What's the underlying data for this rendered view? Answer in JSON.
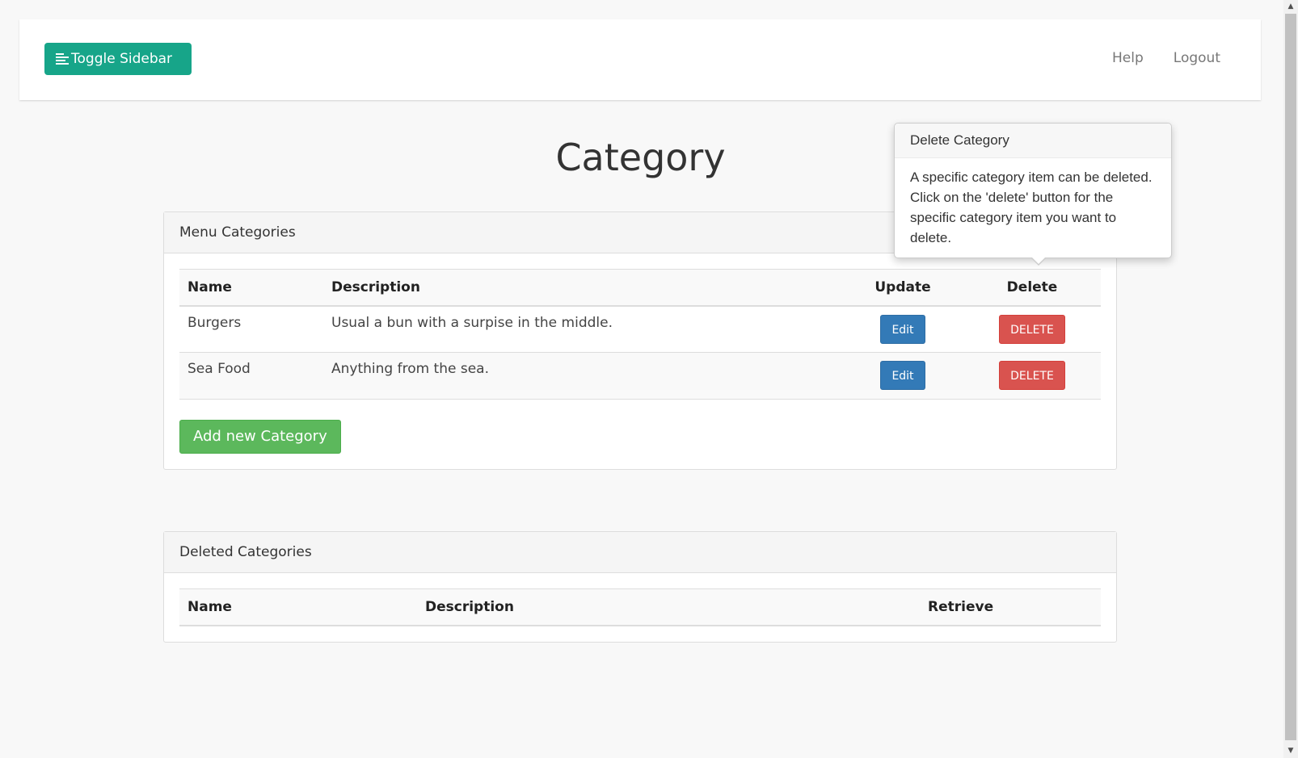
{
  "navbar": {
    "toggle_label": "Toggle Sidebar",
    "help_label": "Help",
    "logout_label": "Logout"
  },
  "page_title": "Category",
  "menu_categories": {
    "title": "Menu Categories",
    "columns": {
      "name": "Name",
      "description": "Description",
      "update": "Update",
      "delete": "Delete"
    },
    "rows": [
      {
        "name": "Burgers",
        "description": "Usual a bun with a surpise in the middle.",
        "edit": "Edit",
        "delete": "DELETE"
      },
      {
        "name": "Sea Food",
        "description": "Anything from the sea.",
        "edit": "Edit",
        "delete": "DELETE"
      }
    ],
    "add_label": "Add new Category"
  },
  "deleted_categories": {
    "title": "Deleted Categories",
    "columns": {
      "name": "Name",
      "description": "Description",
      "retrieve": "Retrieve"
    }
  },
  "popover": {
    "title": "Delete Category",
    "content": "A specific category item can be deleted. Click on the 'delete' button for the specific category item you want to delete."
  },
  "colors": {
    "toggle": "#17a589",
    "edit": "#337ab7",
    "delete": "#d9534f",
    "add": "#5cb85c"
  }
}
